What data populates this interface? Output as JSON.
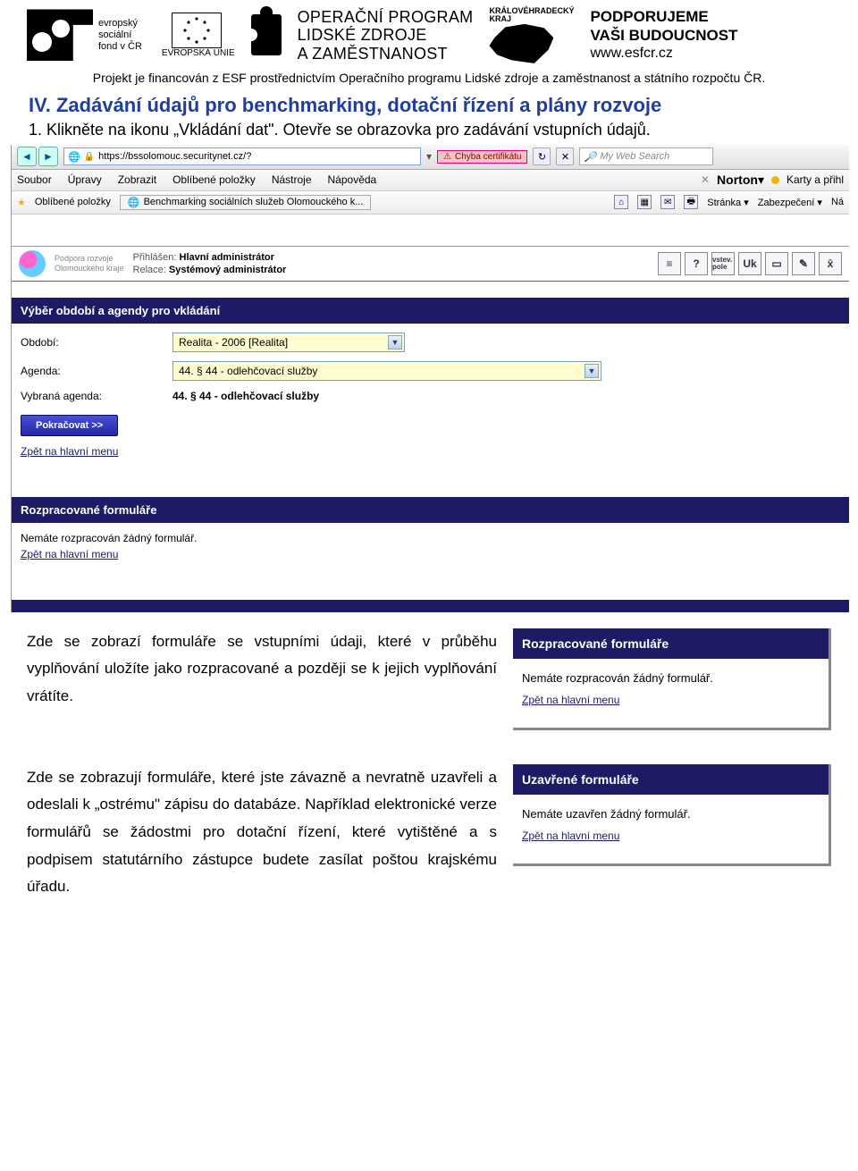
{
  "header": {
    "esf_label_line1": "evropský",
    "esf_label_line2": "sociální",
    "esf_label_line3": "fond v ČR",
    "eu_label": "EVROPSKÁ UNIE",
    "op_line1": "OPERAČNÍ PROGRAM",
    "op_line2": "LIDSKÉ ZDROJE",
    "op_line3": "A ZAMĚSTNANOST",
    "kraj_line1": "KRÁLOVÉHRADECKÝ",
    "kraj_line2": "KRAJ",
    "support_line1": "PODPORUJEME",
    "support_line2": "VAŠI BUDOUCNOST",
    "support_www": "www.esfcr.cz"
  },
  "funding_line": "Projekt je financován z ESF prostřednictvím Operačního programu Lidské zdroje a zaměstnanost a státního rozpočtu ČR.",
  "doc": {
    "heading": "IV. Zadávání údajů pro benchmarking, dotační řízení a plány rozvoje",
    "step1": "1. Klikněte na ikonu „Vkládání dat\". Otevře se obrazovka pro zadávání vstupních údajů."
  },
  "ie": {
    "url": "https://bssolomouc.securitynet.cz/?",
    "cert_error": "Chyba certifikátu",
    "search_placeholder": "My Web Search",
    "menu": [
      "Soubor",
      "Úpravy",
      "Zobrazit",
      "Oblíbené položky",
      "Nástroje",
      "Nápověda"
    ],
    "norton": "Norton",
    "norton_right": "Karty a přihl",
    "fav_label": "Oblíbené položky",
    "tab_title": "Benchmarking sociálních služeb Olomouckého k...",
    "toolbar_right": [
      "Stránka ▾",
      "Zabezpečení ▾",
      "Ná"
    ]
  },
  "app": {
    "logo_sub1": "Podpora rozvoje",
    "logo_sub2": "Olomouckého kraje",
    "logged_in_label": "Přihlášen:",
    "logged_in_value": "Hlavní administrátor",
    "role_label": "Relace:",
    "role_value": "Systémový administrátor",
    "icon_labels": [
      "≡",
      "?",
      "vstev. pole",
      "Uk",
      "▭",
      "✎",
      "x̄"
    ],
    "section1_title": "Výběr období a agendy pro vkládání",
    "period_label": "Období:",
    "period_value": "Realita - 2006 [Realita]",
    "agenda_label": "Agenda:",
    "agenda_value": "44. § 44 - odlehčovací služby",
    "selected_agenda_label": "Vybraná agenda:",
    "selected_agenda_value": "44. § 44 - odlehčovací služby",
    "continue_btn": "Pokračovat >>",
    "back_link": "Zpět na hlavní menu",
    "section2_title": "Rozpracované formuláře",
    "no_drafts": "Nemáte rozpracován žádný formulář.",
    "section3_title_truncated": "Uzavřené formuláře"
  },
  "para1": "Zde se zobrazí formuláře se vstupními údaji, které v průběhu vyplňování uložíte jako rozpracované a později se k jejich vyplňování vrátíte.",
  "panel1": {
    "title": "Rozpracované formuláře",
    "body": "Nemáte rozpracován žádný formulář.",
    "back": "Zpět na hlavní menu"
  },
  "para2": "Zde se zobrazují formuláře, které jste závazně a nevratně uzavřeli a odeslali k „ostrému\" zápisu do databáze. Například elektronické verze formulářů se žádostmi pro dotační řízení, které vytištěné a s podpisem statutárního zástupce budete zasílat poštou krajskému úřadu.",
  "panel2": {
    "title": "Uzavřené formuláře",
    "body": "Nemáte uzavřen žádný formulář.",
    "back": "Zpět na hlavní menu"
  }
}
